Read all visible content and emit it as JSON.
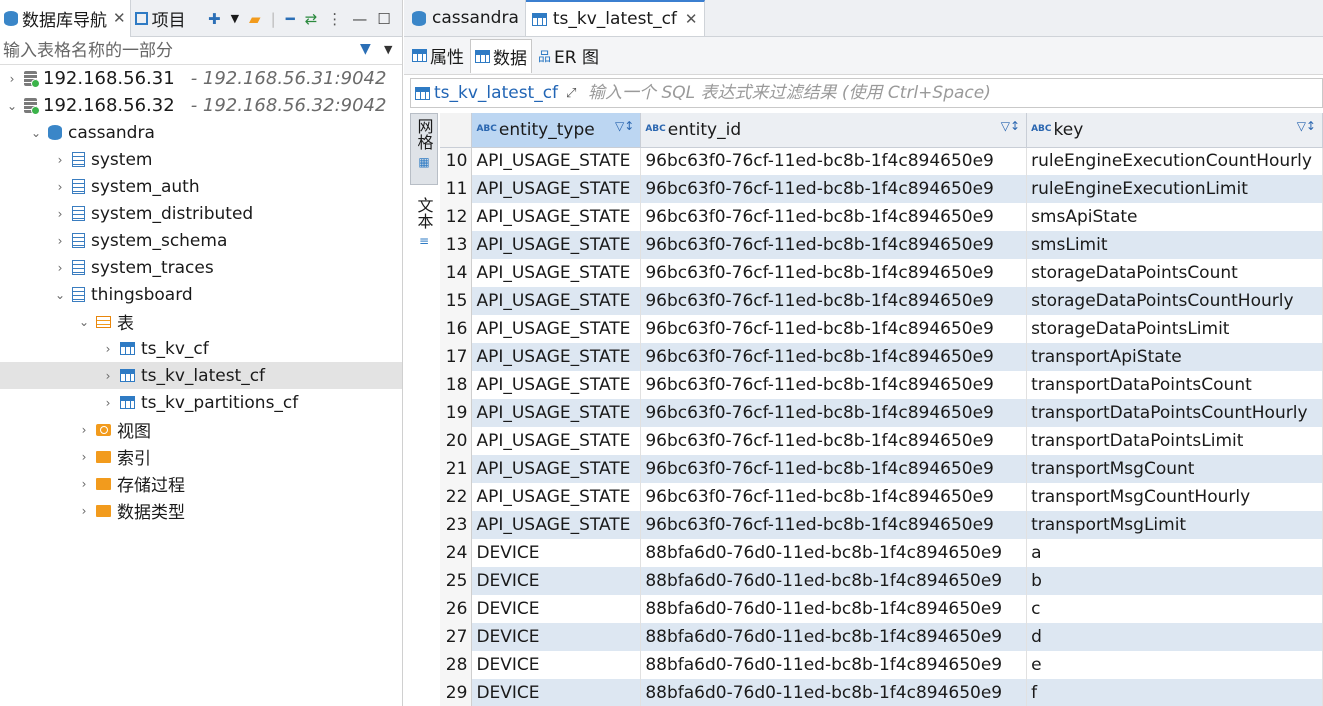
{
  "navigator": {
    "tab_navigator": "数据库导航",
    "tab_projects": "项目",
    "search_placeholder": "输入表格名称的一部分",
    "tree": [
      {
        "label": "192.168.56.31",
        "sub": " - 192.168.56.31:9042",
        "icon": "server-icon",
        "arrow": "›"
      },
      {
        "label": "192.168.56.32",
        "sub": " - 192.168.56.32:9042",
        "icon": "server-icon",
        "arrow": "⌄"
      },
      {
        "label": "cassandra",
        "icon": "database-icon",
        "arrow": "⌄"
      },
      {
        "label": "system",
        "icon": "schema-icon",
        "arrow": "›"
      },
      {
        "label": "system_auth",
        "icon": "schema-icon",
        "arrow": "›"
      },
      {
        "label": "system_distributed",
        "icon": "schema-icon",
        "arrow": "›"
      },
      {
        "label": "system_schema",
        "icon": "schema-icon",
        "arrow": "›"
      },
      {
        "label": "system_traces",
        "icon": "schema-icon",
        "arrow": "›"
      },
      {
        "label": "thingsboard",
        "icon": "schema-icon",
        "arrow": "⌄"
      },
      {
        "label": "表",
        "icon": "tables-folder-icon",
        "arrow": "⌄"
      },
      {
        "label": "ts_kv_cf",
        "icon": "table-icon",
        "arrow": "›"
      },
      {
        "label": "ts_kv_latest_cf",
        "icon": "table-icon",
        "arrow": "›"
      },
      {
        "label": "ts_kv_partitions_cf",
        "icon": "table-icon",
        "arrow": "›"
      },
      {
        "label": "视图",
        "icon": "view-icon",
        "arrow": "›"
      },
      {
        "label": "索引",
        "icon": "folder-icon",
        "arrow": "›"
      },
      {
        "label": "存储过程",
        "icon": "folder-icon",
        "arrow": "›"
      },
      {
        "label": "数据类型",
        "icon": "folder-icon",
        "arrow": "›"
      }
    ]
  },
  "editor": {
    "tabs": [
      {
        "label": "cassandra"
      },
      {
        "label": "ts_kv_latest_cf"
      }
    ],
    "subtabs": {
      "properties": "属性",
      "data": "数据",
      "er": "ER 图"
    },
    "filter": {
      "table_name": "ts_kv_latest_cf",
      "placeholder": "输入一个 SQL 表达式来过滤结果 (使用 Ctrl+Space)"
    },
    "side_tabs": {
      "grid": "网格",
      "text": "文本"
    },
    "columns": [
      "entity_type",
      "entity_id",
      "key"
    ],
    "rows": [
      {
        "n": "10",
        "entity_type": "API_USAGE_STATE",
        "entity_id": "96bc63f0-76cf-11ed-bc8b-1f4c894650e9",
        "key": "ruleEngineExecutionCountHourly"
      },
      {
        "n": "11",
        "entity_type": "API_USAGE_STATE",
        "entity_id": "96bc63f0-76cf-11ed-bc8b-1f4c894650e9",
        "key": "ruleEngineExecutionLimit"
      },
      {
        "n": "12",
        "entity_type": "API_USAGE_STATE",
        "entity_id": "96bc63f0-76cf-11ed-bc8b-1f4c894650e9",
        "key": "smsApiState"
      },
      {
        "n": "13",
        "entity_type": "API_USAGE_STATE",
        "entity_id": "96bc63f0-76cf-11ed-bc8b-1f4c894650e9",
        "key": "smsLimit"
      },
      {
        "n": "14",
        "entity_type": "API_USAGE_STATE",
        "entity_id": "96bc63f0-76cf-11ed-bc8b-1f4c894650e9",
        "key": "storageDataPointsCount"
      },
      {
        "n": "15",
        "entity_type": "API_USAGE_STATE",
        "entity_id": "96bc63f0-76cf-11ed-bc8b-1f4c894650e9",
        "key": "storageDataPointsCountHourly"
      },
      {
        "n": "16",
        "entity_type": "API_USAGE_STATE",
        "entity_id": "96bc63f0-76cf-11ed-bc8b-1f4c894650e9",
        "key": "storageDataPointsLimit"
      },
      {
        "n": "17",
        "entity_type": "API_USAGE_STATE",
        "entity_id": "96bc63f0-76cf-11ed-bc8b-1f4c894650e9",
        "key": "transportApiState"
      },
      {
        "n": "18",
        "entity_type": "API_USAGE_STATE",
        "entity_id": "96bc63f0-76cf-11ed-bc8b-1f4c894650e9",
        "key": "transportDataPointsCount"
      },
      {
        "n": "19",
        "entity_type": "API_USAGE_STATE",
        "entity_id": "96bc63f0-76cf-11ed-bc8b-1f4c894650e9",
        "key": "transportDataPointsCountHourly"
      },
      {
        "n": "20",
        "entity_type": "API_USAGE_STATE",
        "entity_id": "96bc63f0-76cf-11ed-bc8b-1f4c894650e9",
        "key": "transportDataPointsLimit"
      },
      {
        "n": "21",
        "entity_type": "API_USAGE_STATE",
        "entity_id": "96bc63f0-76cf-11ed-bc8b-1f4c894650e9",
        "key": "transportMsgCount"
      },
      {
        "n": "22",
        "entity_type": "API_USAGE_STATE",
        "entity_id": "96bc63f0-76cf-11ed-bc8b-1f4c894650e9",
        "key": "transportMsgCountHourly"
      },
      {
        "n": "23",
        "entity_type": "API_USAGE_STATE",
        "entity_id": "96bc63f0-76cf-11ed-bc8b-1f4c894650e9",
        "key": "transportMsgLimit"
      },
      {
        "n": "24",
        "entity_type": "DEVICE",
        "entity_id": "88bfa6d0-76d0-11ed-bc8b-1f4c894650e9",
        "key": "a"
      },
      {
        "n": "25",
        "entity_type": "DEVICE",
        "entity_id": "88bfa6d0-76d0-11ed-bc8b-1f4c894650e9",
        "key": "b"
      },
      {
        "n": "26",
        "entity_type": "DEVICE",
        "entity_id": "88bfa6d0-76d0-11ed-bc8b-1f4c894650e9",
        "key": "c"
      },
      {
        "n": "27",
        "entity_type": "DEVICE",
        "entity_id": "88bfa6d0-76d0-11ed-bc8b-1f4c894650e9",
        "key": "d"
      },
      {
        "n": "28",
        "entity_type": "DEVICE",
        "entity_id": "88bfa6d0-76d0-11ed-bc8b-1f4c894650e9",
        "key": "e"
      },
      {
        "n": "29",
        "entity_type": "DEVICE",
        "entity_id": "88bfa6d0-76d0-11ed-bc8b-1f4c894650e9",
        "key": "f"
      }
    ]
  },
  "colors": {
    "accent": "#3b7fd0",
    "row_alt": "#dde7f2",
    "header_selected": "#bcd6f2",
    "folder": "#f29b1d"
  }
}
